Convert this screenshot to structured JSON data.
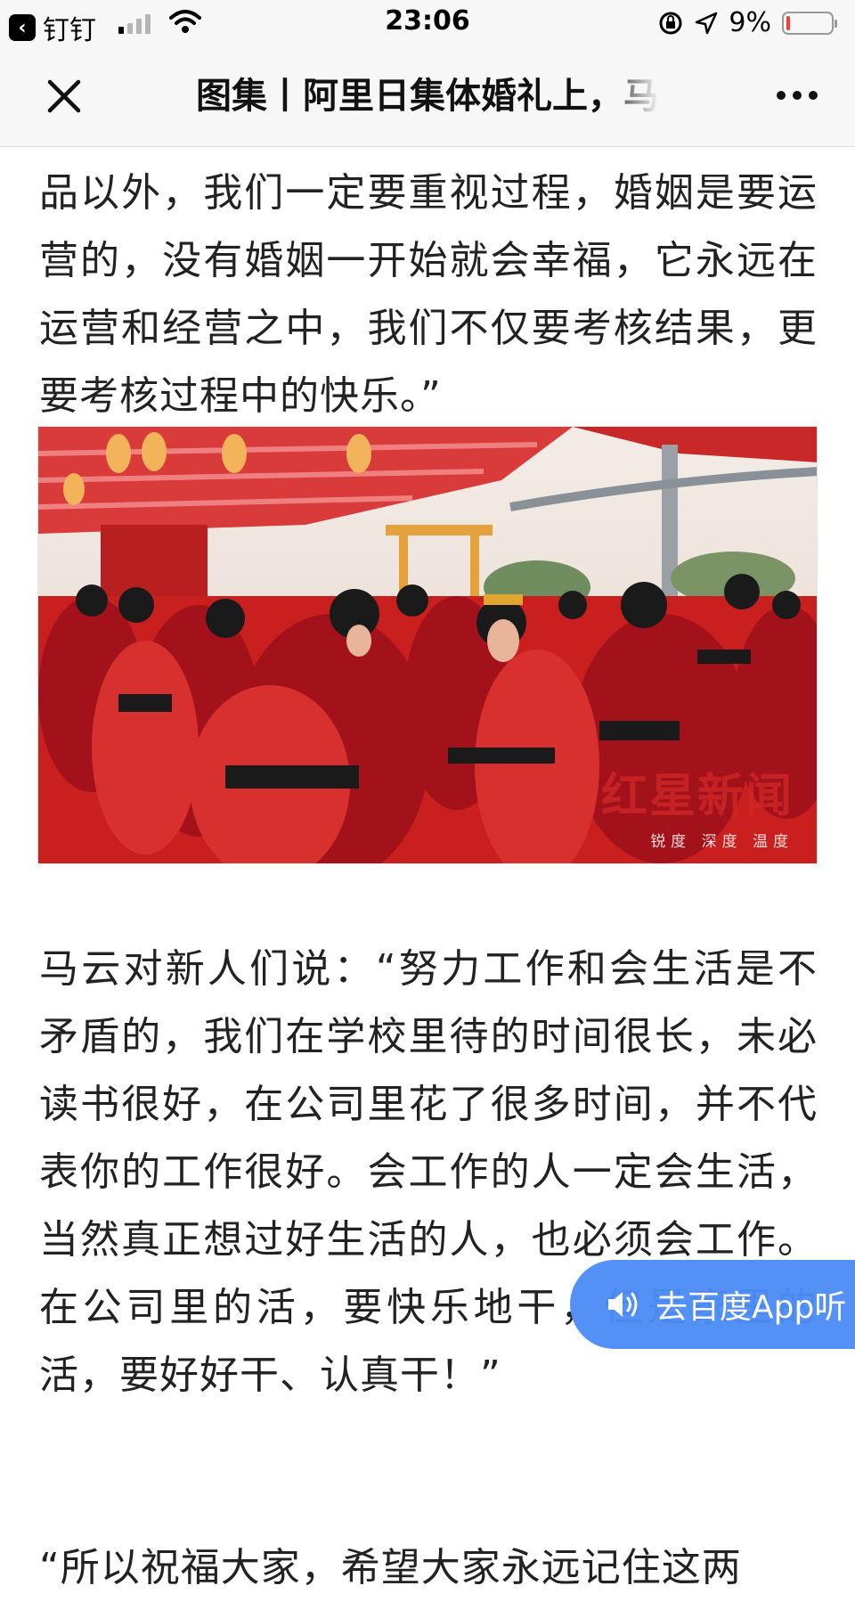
{
  "status_bar": {
    "back_app": "钉钉",
    "time": "23:06",
    "battery_percent": "9%",
    "battery_level": 0.09,
    "signal_bars_active": 1
  },
  "nav": {
    "title": "图集丨阿里日集体婚礼上，马",
    "close_icon": "close-icon",
    "more_icon": "more-dots-icon"
  },
  "article": {
    "para_top": "品以外，我们一定要重视过程，婚姻是要运营的，没有婚姻一开始就会幸福，它永远在运营和经营之中，我们不仅要考核结果，更要考核过程中的快乐。”",
    "image_watermark_title": "红星新闻",
    "image_watermark_sub": "锐度 深度 温度",
    "para_main": "马云对新人们说：“努力工作和会生活是不矛盾的，我们在学校里待的时间很长，未必读书很好，在公司里花了很多时间，并不代表你的工作很好。会工作的人一定会生活，当然真正想过好生活的人，也必须会工作。在公司里的活，要快乐地干，但是家里的活，要好好干、认真干！”",
    "para_bottom": "“所以祝福大家，希望大家永远记住这两"
  },
  "listen_button": {
    "label": "去百度App听",
    "icon": "speaker-icon",
    "color": "#4d8df7"
  },
  "colors": {
    "nav_bg": "#f7f7f7",
    "text": "#222222",
    "accent_red": "#d42a2a"
  }
}
